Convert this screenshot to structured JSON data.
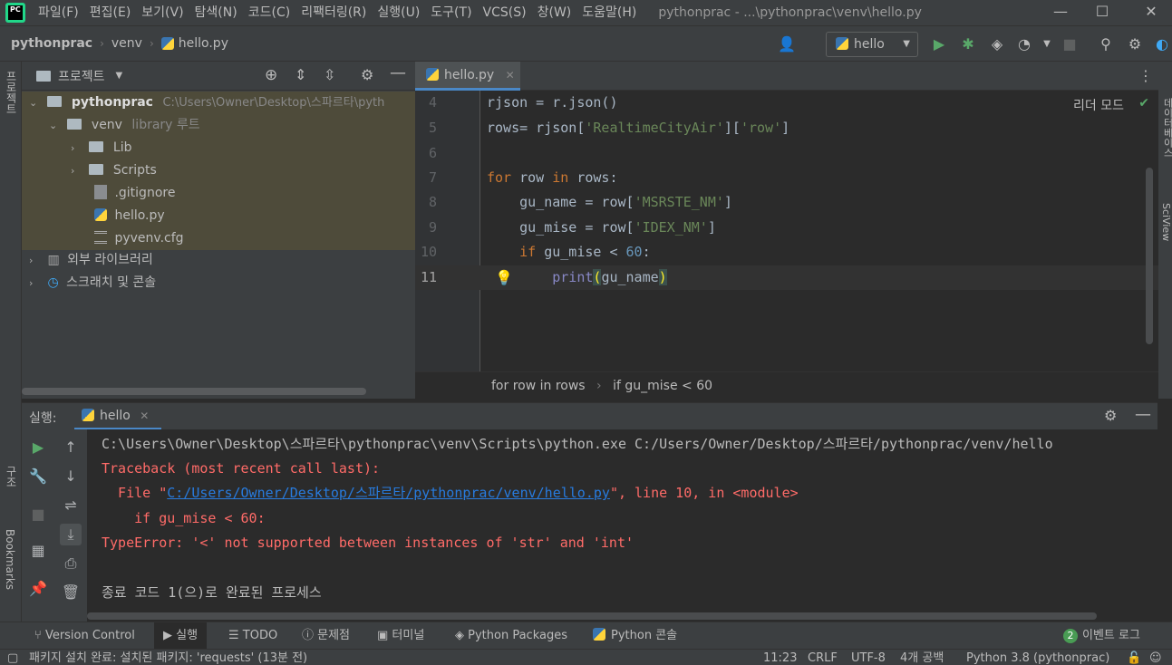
{
  "menubar": {
    "items": [
      "파일(F)",
      "편집(E)",
      "보기(V)",
      "탐색(N)",
      "코드(C)",
      "리팩터링(R)",
      "실행(U)",
      "도구(T)",
      "VCS(S)",
      "창(W)",
      "도움말(H)"
    ],
    "title": "pythonprac - ...\\pythonprac\\venv\\hello.py"
  },
  "navbar": {
    "crumbs": [
      "pythonprac",
      "venv",
      "hello.py"
    ],
    "run_config": "hello"
  },
  "leftstrip": {
    "project_label": "프로젝트",
    "structure_label": "구조",
    "bookmarks_label": "Bookmarks"
  },
  "project": {
    "title": "프로젝트",
    "root_name": "pythonprac",
    "root_path": "C:\\Users\\Owner\\Desktop\\스파르타\\pyth",
    "venv": "venv",
    "venv_suffix": "library 루트",
    "lib": "Lib",
    "scripts": "Scripts",
    "gitignore": ".gitignore",
    "hello": "hello.py",
    "pyvenv": "pyvenv.cfg",
    "ext_libs": "외부 라이브러리",
    "scratches": "스크래치 및 콘솔"
  },
  "editor": {
    "tab": "hello.py",
    "reader_mode": "리더 모드",
    "lines": [
      {
        "n": "4",
        "code": "rjson = r.json()"
      },
      {
        "n": "5",
        "code": "rows= rjson['RealtimeCityAir']['row']"
      },
      {
        "n": "6",
        "code": ""
      },
      {
        "n": "7",
        "code": "for row in rows:"
      },
      {
        "n": "8",
        "code": "    gu_name = row['MSRSTE_NM']"
      },
      {
        "n": "9",
        "code": "    gu_mise = row['IDEX_NM']"
      },
      {
        "n": "10",
        "code": "    if gu_mise < 60:"
      },
      {
        "n": "11",
        "code": "        print(gu_name)"
      }
    ],
    "breadcrumb": [
      "for row in rows",
      "if gu_mise < 60"
    ]
  },
  "rightstrip": {
    "db_label": "데이터베이스",
    "sciview_label": "SciView"
  },
  "run": {
    "label": "실행:",
    "tab": "hello",
    "console": [
      "C:\\Users\\Owner\\Desktop\\스파르타\\pythonprac\\venv\\Scripts\\python.exe C:/Users/Owner/Desktop/스파르타/pythonprac/venv/hello",
      "Traceback (most recent call last):",
      "  File \"",
      "C:/Users/Owner/Desktop/스파르타/pythonprac/venv/hello.py",
      "\", line 10, in <module>",
      "    if gu_mise < 60:",
      "TypeError: '<' not supported between instances of 'str' and 'int'",
      "종료 코드 1(으)로 완료된 프로세스"
    ]
  },
  "bottombar": {
    "tabs": [
      "Version Control",
      "실행",
      "TODO",
      "문제점",
      "터미널",
      "Python Packages",
      "Python 콘솔"
    ],
    "event_count": "2",
    "event_log": "이벤트 로그"
  },
  "statusbar": {
    "message": "패키지 설치 완료: 설치된 패키지: 'requests' (13분 전)",
    "position": "11:23",
    "line_sep": "CRLF",
    "encoding": "UTF-8",
    "indent": "4개 공백",
    "interpreter": "Python 3.8 (pythonprac)"
  },
  "colors": {
    "background": "#2b2b2b",
    "panel": "#3c3f41",
    "keyword": "#cc7832",
    "string": "#6a8759",
    "number": "#6897bb",
    "error": "#ff6b68",
    "link": "#287bde",
    "run_green": "#59a869"
  }
}
